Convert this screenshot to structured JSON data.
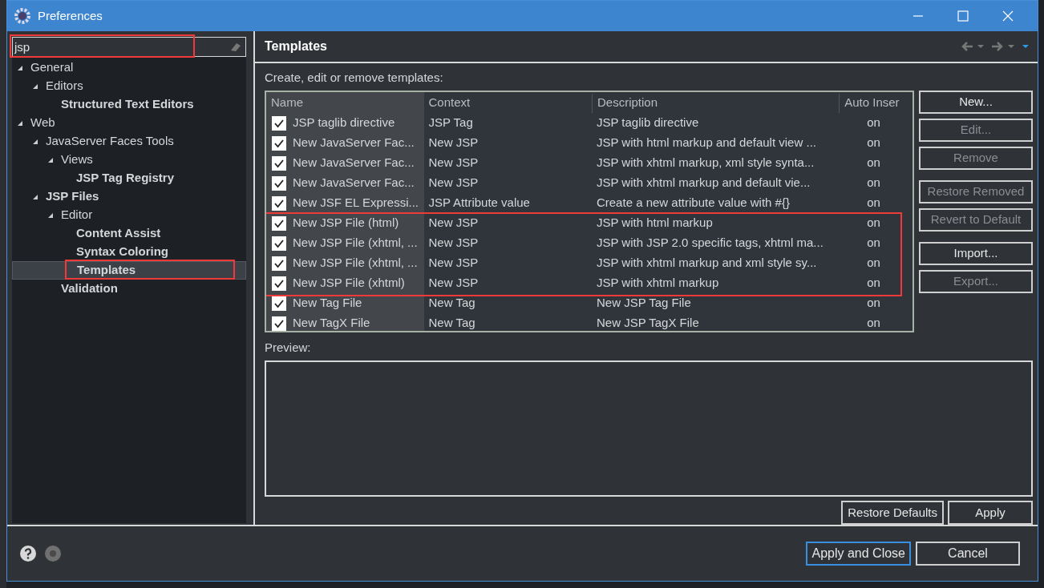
{
  "window": {
    "title": "Preferences"
  },
  "filter": {
    "value": "jsp"
  },
  "tree": [
    {
      "label": "General",
      "bold": false,
      "expanded": true,
      "selected": false,
      "children": [
        {
          "label": "Editors",
          "bold": false,
          "expanded": true,
          "selected": false,
          "children": [
            {
              "label": "Structured Text Editors",
              "bold": true,
              "selected": false
            }
          ]
        }
      ]
    },
    {
      "label": "Web",
      "bold": false,
      "expanded": true,
      "selected": false,
      "children": [
        {
          "label": "JavaServer Faces Tools",
          "bold": false,
          "expanded": true,
          "selected": false,
          "children": [
            {
              "label": "Views",
              "bold": false,
              "expanded": true,
              "selected": false,
              "children": [
                {
                  "label": "JSP Tag Registry",
                  "bold": true,
                  "selected": false
                }
              ]
            }
          ]
        },
        {
          "label": "JSP Files",
          "bold": true,
          "expanded": true,
          "selected": false,
          "children": [
            {
              "label": "Editor",
              "bold": false,
              "expanded": true,
              "selected": false,
              "children": [
                {
                  "label": "Content Assist",
                  "bold": true,
                  "selected": false
                },
                {
                  "label": "Syntax Coloring",
                  "bold": true,
                  "selected": false
                },
                {
                  "label": "Templates",
                  "bold": true,
                  "selected": true
                }
              ]
            },
            {
              "label": "Validation",
              "bold": true,
              "selected": false
            }
          ]
        }
      ]
    }
  ],
  "page": {
    "title": "Templates",
    "intro": "Create, edit or remove templates:",
    "table": {
      "columns": [
        "Name",
        "Context",
        "Description",
        "Auto Inser"
      ],
      "rows": [
        {
          "checked": true,
          "name": "JSP taglib directive",
          "context": "JSP Tag",
          "description": "JSP taglib directive",
          "auto_insert": "on"
        },
        {
          "checked": true,
          "name": "New JavaServer Fac...",
          "context": "New JSP",
          "description": "JSP with html markup and default view ...",
          "auto_insert": "on"
        },
        {
          "checked": true,
          "name": "New JavaServer Fac...",
          "context": "New JSP",
          "description": "JSP with xhtml markup, xml style synta...",
          "auto_insert": "on"
        },
        {
          "checked": true,
          "name": "New JavaServer Fac...",
          "context": "New JSP",
          "description": "JSP with xhtml markup and default vie...",
          "auto_insert": "on"
        },
        {
          "checked": true,
          "name": "New JSF EL Expressi...",
          "context": "JSP Attribute value",
          "description": "Create a new attribute value with #{}",
          "auto_insert": "on"
        },
        {
          "checked": true,
          "name": "New JSP File (html)",
          "context": "New JSP",
          "description": "JSP with html markup",
          "auto_insert": "on"
        },
        {
          "checked": true,
          "name": "New JSP File (xhtml, ...",
          "context": "New JSP",
          "description": "JSP with JSP 2.0 specific tags, xhtml ma...",
          "auto_insert": "on"
        },
        {
          "checked": true,
          "name": "New JSP File (xhtml, ...",
          "context": "New JSP",
          "description": "JSP with xhtml markup and xml style sy...",
          "auto_insert": "on"
        },
        {
          "checked": true,
          "name": "New JSP File (xhtml)",
          "context": "New JSP",
          "description": "JSP with xhtml markup",
          "auto_insert": "on"
        },
        {
          "checked": true,
          "name": "New Tag File",
          "context": "New Tag",
          "description": "New JSP Tag File",
          "auto_insert": "on"
        },
        {
          "checked": true,
          "name": "New TagX File",
          "context": "New Tag",
          "description": "New JSP TagX File",
          "auto_insert": "on"
        }
      ]
    },
    "side_button_groups": [
      [
        {
          "label": "New...",
          "disabled": false
        },
        {
          "label": "Edit...",
          "disabled": true
        },
        {
          "label": "Remove",
          "disabled": true
        }
      ],
      [
        {
          "label": "Restore Removed",
          "disabled": true
        },
        {
          "label": "Revert to Default",
          "disabled": true
        }
      ],
      [
        {
          "label": "Import...",
          "disabled": false
        },
        {
          "label": "Export...",
          "disabled": true
        }
      ]
    ],
    "preview_label": "Preview:",
    "page_buttons": [
      "Restore Defaults",
      "Apply"
    ]
  },
  "footer_buttons": [
    {
      "label": "Apply and Close",
      "default": true
    },
    {
      "label": "Cancel",
      "default": false
    }
  ]
}
